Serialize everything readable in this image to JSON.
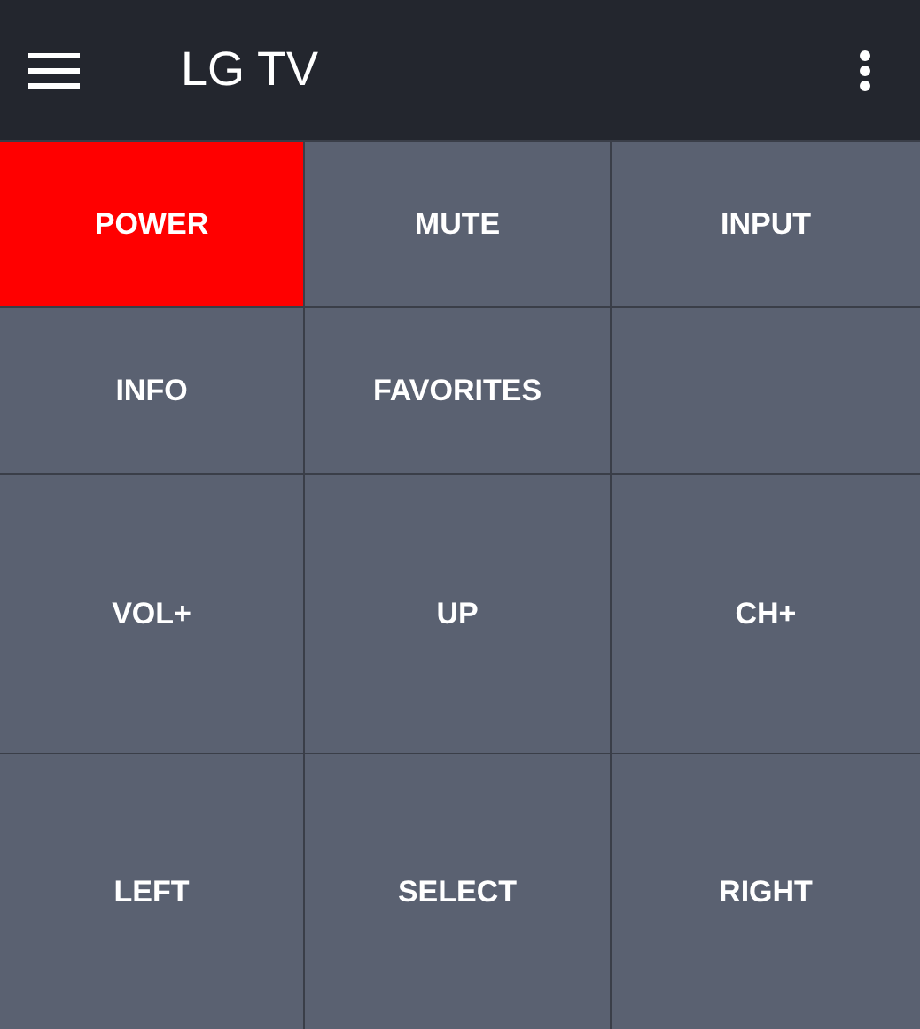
{
  "app_bar": {
    "title": "LG TV"
  },
  "buttons": [
    {
      "label": "POWER",
      "color": "#ff0000"
    },
    {
      "label": "MUTE",
      "color": "#5a6171"
    },
    {
      "label": "INPUT",
      "color": "#5a6171"
    },
    {
      "label": "INFO",
      "color": "#5a6171"
    },
    {
      "label": "FAVORITES",
      "color": "#5a6171"
    },
    {
      "color": "#5a6171"
    },
    {
      "label": "VOL+",
      "color": "#5a6171"
    },
    {
      "label": "UP",
      "color": "#5a6171"
    },
    {
      "label": "CH+",
      "color": "#5a6171"
    },
    {
      "label": "LEFT",
      "color": "#5a6171"
    },
    {
      "label": "SELECT",
      "color": "#5a6171"
    },
    {
      "label": "RIGHT",
      "color": "#5a6171"
    }
  ]
}
